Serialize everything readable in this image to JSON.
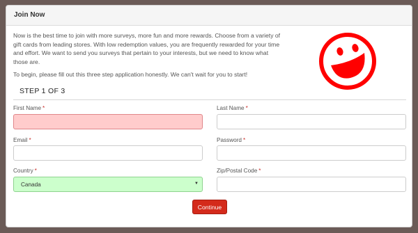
{
  "panel": {
    "title": "Join Now"
  },
  "intro": {
    "paragraph1": "Now is the best time to join with more surveys, more fun and more rewards. Choose from a variety of gift cards from leading stores. With low redemption values, you are frequently rewarded for your time and effort. We want to send you surveys that pertain to your interests, but we need to know what those are.",
    "paragraph2": "To begin, please fill out this three step application honestly. We can't wait for you to start!"
  },
  "logo": {
    "icon": "smiley-icon",
    "color": "#ff0000"
  },
  "form": {
    "step_title": "STEP 1 OF 3",
    "required_marker": "*",
    "first_name": {
      "label": "First Name",
      "value": "",
      "state": "error"
    },
    "last_name": {
      "label": "Last Name",
      "value": ""
    },
    "email": {
      "label": "Email",
      "value": ""
    },
    "password": {
      "label": "Password",
      "value": ""
    },
    "country": {
      "label": "Country",
      "value": "Canada",
      "state": "valid"
    },
    "zip": {
      "label": "Zip/Postal Code",
      "value": ""
    },
    "submit_label": "Continue"
  },
  "colors": {
    "background": "#6b5b57",
    "error_fill": "#ffcccc",
    "valid_fill": "#ccffcc",
    "button": "#d42a1b",
    "required": "#c9302c"
  }
}
